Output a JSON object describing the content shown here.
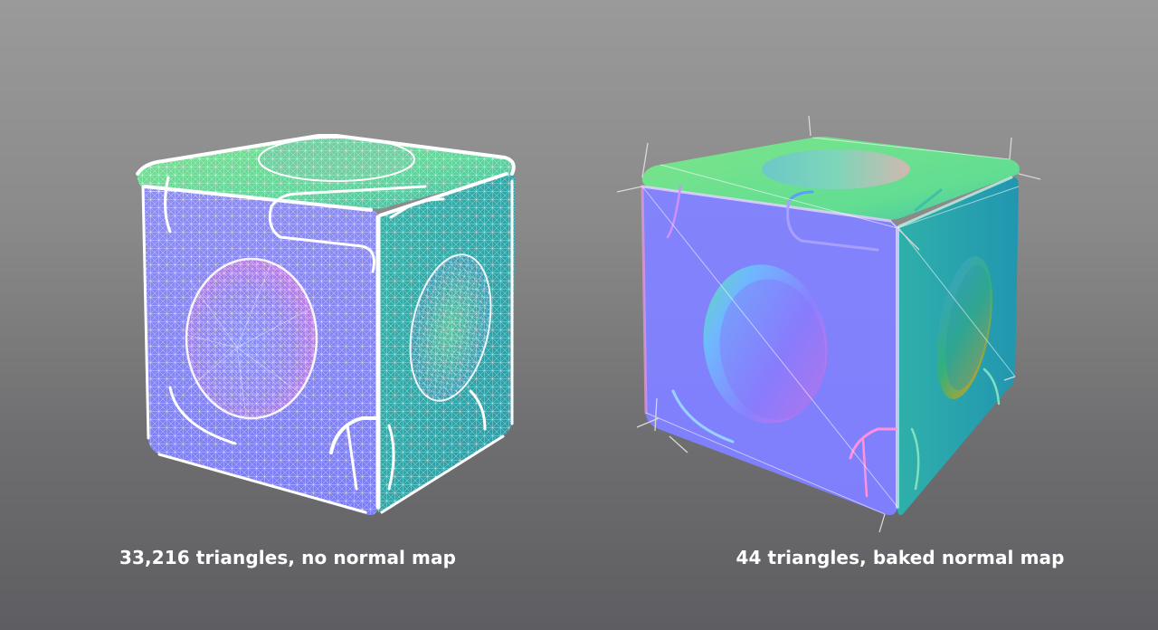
{
  "figures": [
    {
      "caption": "33,216 triangles, no normal map",
      "render": "high-poly wireframe cube"
    },
    {
      "caption": "44 triangles, baked normal map",
      "render": "low-poly normal-mapped cube"
    }
  ],
  "colors": {
    "background_top": "#9a9a9a",
    "background_bottom": "#5e5e62",
    "normal_blue": "#7f7fff",
    "normal_green": "#5fe08f",
    "normal_teal": "#2fa7b0",
    "caption_text": "#ffffff"
  }
}
